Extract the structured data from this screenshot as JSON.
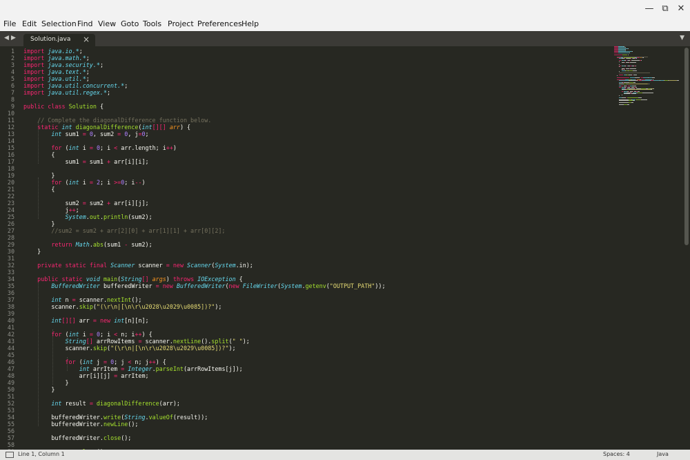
{
  "menus": [
    "File",
    "Edit",
    "Selection",
    "Find",
    "View",
    "Goto",
    "Tools",
    "Project",
    "Preferences",
    "Help"
  ],
  "tabbar": {
    "nav_left": "◀",
    "nav_right": "▶",
    "active_tab": "Solution.java",
    "close": "×",
    "dropdown": "▼"
  },
  "window": {
    "minimize": "—",
    "maximize": "⧉",
    "close": "✕"
  },
  "status": {
    "position": "Line 1, Column 1",
    "spaces": "Spaces: 4",
    "syntax": "Java"
  },
  "colors": {
    "k": "#f92672",
    "t": "#66d9ef",
    "f": "#a6e22e",
    "s": "#e6db74",
    "n": "#ae81ff",
    "c": "#75715e",
    "p": "#fd971f",
    "x": "#f8f8f2"
  },
  "lines": [
    [
      [
        "k",
        "import "
      ],
      [
        "t",
        "java.io.*"
      ],
      [
        "x",
        ";"
      ]
    ],
    [
      [
        "k",
        "import "
      ],
      [
        "t",
        "java.math.*"
      ],
      [
        "x",
        ";"
      ]
    ],
    [
      [
        "k",
        "import "
      ],
      [
        "t",
        "java.security.*"
      ],
      [
        "x",
        ";"
      ]
    ],
    [
      [
        "k",
        "import "
      ],
      [
        "t",
        "java.text.*"
      ],
      [
        "x",
        ";"
      ]
    ],
    [
      [
        "k",
        "import "
      ],
      [
        "t",
        "java.util.*"
      ],
      [
        "x",
        ";"
      ]
    ],
    [
      [
        "k",
        "import "
      ],
      [
        "t",
        "java.util.concurrent.*"
      ],
      [
        "x",
        ";"
      ]
    ],
    [
      [
        "k",
        "import "
      ],
      [
        "t",
        "java.util.regex.*"
      ],
      [
        "x",
        ";"
      ]
    ],
    [],
    [
      [
        "k",
        "public "
      ],
      [
        "k",
        "class "
      ],
      [
        "f",
        "Solution"
      ],
      [
        "x",
        " {"
      ]
    ],
    [],
    [
      [
        "c",
        "    // Complete the diagonalDifference function below."
      ]
    ],
    [
      [
        "x",
        "    "
      ],
      [
        "k",
        "static "
      ],
      [
        "t",
        "int "
      ],
      [
        "f",
        "diagonalDifference"
      ],
      [
        "x",
        "("
      ],
      [
        "t",
        "int"
      ],
      [
        "k",
        "[][]"
      ],
      [
        "x",
        " "
      ],
      [
        "p",
        "arr"
      ],
      [
        "x",
        ") {"
      ]
    ],
    [
      [
        "x",
        "        "
      ],
      [
        "t",
        "int "
      ],
      [
        "x",
        "sum1 "
      ],
      [
        "k",
        "="
      ],
      [
        "x",
        " "
      ],
      [
        "n",
        "0"
      ],
      [
        "x",
        ", sum2 "
      ],
      [
        "k",
        "="
      ],
      [
        "x",
        " "
      ],
      [
        "n",
        "0"
      ],
      [
        "x",
        ", j"
      ],
      [
        "k",
        "="
      ],
      [
        "n",
        "0"
      ],
      [
        "x",
        ";"
      ]
    ],
    [],
    [
      [
        "x",
        "        "
      ],
      [
        "k",
        "for"
      ],
      [
        "x",
        " ("
      ],
      [
        "t",
        "int "
      ],
      [
        "x",
        "i "
      ],
      [
        "k",
        "="
      ],
      [
        "x",
        " "
      ],
      [
        "n",
        "0"
      ],
      [
        "x",
        "; i "
      ],
      [
        "k",
        "<"
      ],
      [
        "x",
        " arr.length; i"
      ],
      [
        "k",
        "++"
      ],
      [
        "x",
        ")"
      ]
    ],
    [
      [
        "x",
        "        {"
      ]
    ],
    [
      [
        "x",
        "            sum1 "
      ],
      [
        "k",
        "="
      ],
      [
        "x",
        " sum1 "
      ],
      [
        "k",
        "+"
      ],
      [
        "x",
        " arr[i][i];"
      ]
    ],
    [],
    [
      [
        "x",
        "        }"
      ]
    ],
    [
      [
        "x",
        "        "
      ],
      [
        "k",
        "for"
      ],
      [
        "x",
        " ("
      ],
      [
        "t",
        "int "
      ],
      [
        "x",
        "i "
      ],
      [
        "k",
        "="
      ],
      [
        "x",
        " "
      ],
      [
        "n",
        "2"
      ],
      [
        "x",
        "; i "
      ],
      [
        "k",
        ">="
      ],
      [
        "n",
        "0"
      ],
      [
        "x",
        "; i"
      ],
      [
        "k",
        "--"
      ],
      [
        "x",
        ")"
      ]
    ],
    [
      [
        "x",
        "        {"
      ]
    ],
    [],
    [
      [
        "x",
        "            sum2 "
      ],
      [
        "k",
        "="
      ],
      [
        "x",
        " sum2 "
      ],
      [
        "k",
        "+"
      ],
      [
        "x",
        " arr[i][j];"
      ]
    ],
    [
      [
        "x",
        "            j"
      ],
      [
        "k",
        "++"
      ],
      [
        "x",
        ";"
      ]
    ],
    [
      [
        "x",
        "            "
      ],
      [
        "t",
        "System"
      ],
      [
        "x",
        "."
      ],
      [
        "f",
        "out"
      ],
      [
        "x",
        "."
      ],
      [
        "f",
        "println"
      ],
      [
        "x",
        "(sum2);"
      ]
    ],
    [
      [
        "x",
        "        }"
      ]
    ],
    [
      [
        "c",
        "        //sum2 = sum2 + arr[2][0] + arr[1][1] + arr[0][2];"
      ]
    ],
    [],
    [
      [
        "x",
        "        "
      ],
      [
        "k",
        "return "
      ],
      [
        "t",
        "Math"
      ],
      [
        "x",
        "."
      ],
      [
        "f",
        "abs"
      ],
      [
        "x",
        "(sum1 "
      ],
      [
        "k",
        "-"
      ],
      [
        "x",
        " sum2);"
      ]
    ],
    [
      [
        "x",
        "    }"
      ]
    ],
    [],
    [
      [
        "x",
        "    "
      ],
      [
        "k",
        "private "
      ],
      [
        "k",
        "static "
      ],
      [
        "k",
        "final "
      ],
      [
        "t",
        "Scanner "
      ],
      [
        "x",
        "scanner "
      ],
      [
        "k",
        "="
      ],
      [
        "x",
        " "
      ],
      [
        "k",
        "new "
      ],
      [
        "t",
        "Scanner"
      ],
      [
        "x",
        "("
      ],
      [
        "t",
        "System"
      ],
      [
        "x",
        ".in);"
      ]
    ],
    [],
    [
      [
        "x",
        "    "
      ],
      [
        "k",
        "public "
      ],
      [
        "k",
        "static "
      ],
      [
        "t",
        "void "
      ],
      [
        "f",
        "main"
      ],
      [
        "x",
        "("
      ],
      [
        "t",
        "String"
      ],
      [
        "k",
        "[]"
      ],
      [
        "x",
        " "
      ],
      [
        "p",
        "args"
      ],
      [
        "x",
        ") "
      ],
      [
        "k",
        "throws "
      ],
      [
        "t",
        "IOException"
      ],
      [
        "x",
        " {"
      ]
    ],
    [
      [
        "x",
        "        "
      ],
      [
        "t",
        "BufferedWriter "
      ],
      [
        "x",
        "bufferedWriter "
      ],
      [
        "k",
        "="
      ],
      [
        "x",
        " "
      ],
      [
        "k",
        "new "
      ],
      [
        "t",
        "BufferedWriter"
      ],
      [
        "x",
        "("
      ],
      [
        "k",
        "new "
      ],
      [
        "t",
        "FileWriter"
      ],
      [
        "x",
        "("
      ],
      [
        "t",
        "System"
      ],
      [
        "x",
        "."
      ],
      [
        "f",
        "getenv"
      ],
      [
        "x",
        "("
      ],
      [
        "s",
        "\"OUTPUT_PATH\""
      ],
      [
        "x",
        "));"
      ]
    ],
    [],
    [
      [
        "x",
        "        "
      ],
      [
        "t",
        "int "
      ],
      [
        "x",
        "n "
      ],
      [
        "k",
        "="
      ],
      [
        "x",
        " scanner."
      ],
      [
        "f",
        "nextInt"
      ],
      [
        "x",
        "();"
      ]
    ],
    [
      [
        "x",
        "        scanner."
      ],
      [
        "f",
        "skip"
      ],
      [
        "x",
        "("
      ],
      [
        "s",
        "\"(\\r\\n|[\\n\\r\\u2028\\u2029\\u0085])?\""
      ],
      [
        "x",
        ");"
      ]
    ],
    [],
    [
      [
        "x",
        "        "
      ],
      [
        "t",
        "int"
      ],
      [
        "k",
        "[][]"
      ],
      [
        "x",
        " arr "
      ],
      [
        "k",
        "="
      ],
      [
        "x",
        " "
      ],
      [
        "k",
        "new "
      ],
      [
        "t",
        "int"
      ],
      [
        "x",
        "[n][n];"
      ]
    ],
    [],
    [
      [
        "x",
        "        "
      ],
      [
        "k",
        "for"
      ],
      [
        "x",
        " ("
      ],
      [
        "t",
        "int "
      ],
      [
        "x",
        "i "
      ],
      [
        "k",
        "="
      ],
      [
        "x",
        " "
      ],
      [
        "n",
        "0"
      ],
      [
        "x",
        "; i "
      ],
      [
        "k",
        "<"
      ],
      [
        "x",
        " n; i"
      ],
      [
        "k",
        "++"
      ],
      [
        "x",
        ") {"
      ]
    ],
    [
      [
        "x",
        "            "
      ],
      [
        "t",
        "String"
      ],
      [
        "k",
        "[]"
      ],
      [
        "x",
        " arrRowItems "
      ],
      [
        "k",
        "="
      ],
      [
        "x",
        " scanner."
      ],
      [
        "f",
        "nextLine"
      ],
      [
        "x",
        "()."
      ],
      [
        "f",
        "split"
      ],
      [
        "x",
        "("
      ],
      [
        "s",
        "\" \""
      ],
      [
        "x",
        ");"
      ]
    ],
    [
      [
        "x",
        "            scanner."
      ],
      [
        "f",
        "skip"
      ],
      [
        "x",
        "("
      ],
      [
        "s",
        "\"(\\r\\n|[\\n\\r\\u2028\\u2029\\u0085])?\""
      ],
      [
        "x",
        ");"
      ]
    ],
    [],
    [
      [
        "x",
        "            "
      ],
      [
        "k",
        "for"
      ],
      [
        "x",
        " ("
      ],
      [
        "t",
        "int "
      ],
      [
        "x",
        "j "
      ],
      [
        "k",
        "="
      ],
      [
        "x",
        " "
      ],
      [
        "n",
        "0"
      ],
      [
        "x",
        "; j "
      ],
      [
        "k",
        "<"
      ],
      [
        "x",
        " n; j"
      ],
      [
        "k",
        "++"
      ],
      [
        "x",
        ") {"
      ]
    ],
    [
      [
        "x",
        "                "
      ],
      [
        "t",
        "int "
      ],
      [
        "x",
        "arrItem "
      ],
      [
        "k",
        "="
      ],
      [
        "x",
        " "
      ],
      [
        "t",
        "Integer"
      ],
      [
        "x",
        "."
      ],
      [
        "f",
        "parseInt"
      ],
      [
        "x",
        "(arrRowItems[j]);"
      ]
    ],
    [
      [
        "x",
        "                arr[i][j] "
      ],
      [
        "k",
        "="
      ],
      [
        "x",
        " arrItem;"
      ]
    ],
    [
      [
        "x",
        "            }"
      ]
    ],
    [
      [
        "x",
        "        }"
      ]
    ],
    [],
    [
      [
        "x",
        "        "
      ],
      [
        "t",
        "int "
      ],
      [
        "x",
        "result "
      ],
      [
        "k",
        "="
      ],
      [
        "x",
        " "
      ],
      [
        "f",
        "diagonalDifference"
      ],
      [
        "x",
        "(arr);"
      ]
    ],
    [],
    [
      [
        "x",
        "        bufferedWriter."
      ],
      [
        "f",
        "write"
      ],
      [
        "x",
        "("
      ],
      [
        "t",
        "String"
      ],
      [
        "x",
        "."
      ],
      [
        "f",
        "valueOf"
      ],
      [
        "x",
        "(result));"
      ]
    ],
    [
      [
        "x",
        "        bufferedWriter."
      ],
      [
        "f",
        "newLine"
      ],
      [
        "x",
        "();"
      ]
    ],
    [],
    [
      [
        "x",
        "        bufferedWriter."
      ],
      [
        "f",
        "close"
      ],
      [
        "x",
        "();"
      ]
    ],
    [],
    [
      [
        "x",
        "        scanner."
      ],
      [
        "f",
        "close"
      ],
      [
        "x",
        "();"
      ]
    ]
  ]
}
